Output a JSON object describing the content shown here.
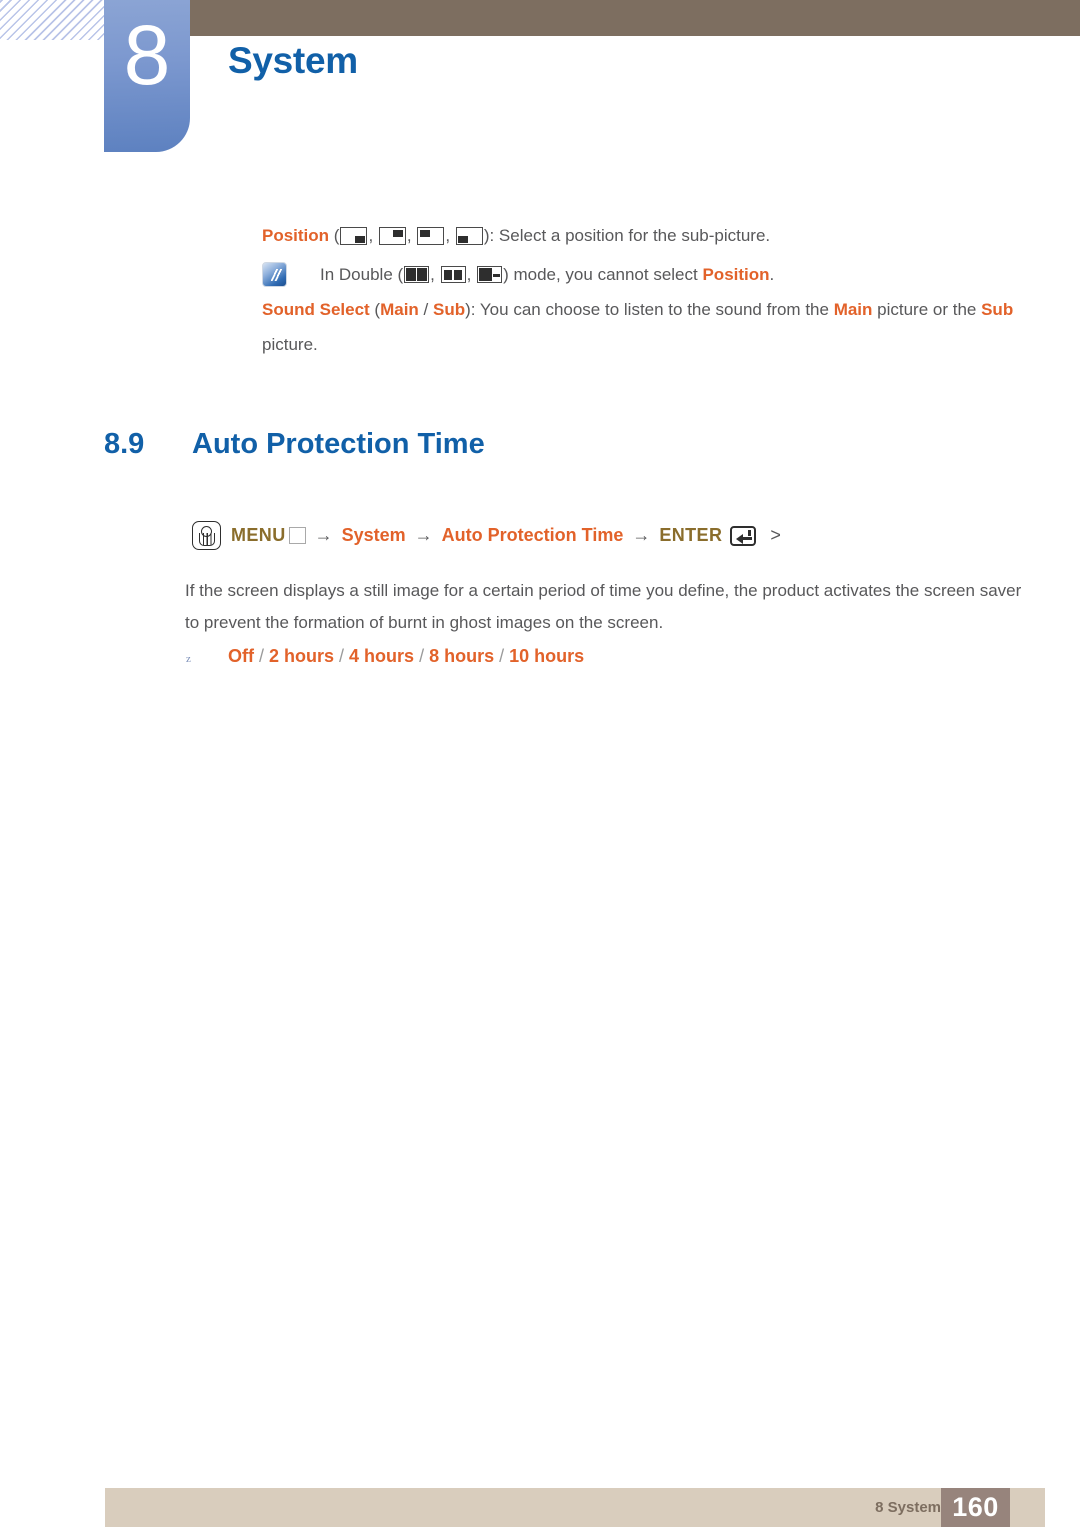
{
  "header": {
    "chapter_number": "8",
    "chapter_title": "System",
    "hatch_icon": "diagonal-hatch-pattern",
    "bar_color": "#7d6e60",
    "tab_color": "#5d81c0",
    "title_color": "#1160a8"
  },
  "notes": {
    "position_note": {
      "keyword": "Position",
      "open_paren": " (",
      "icons": [
        {
          "name": "position-bottom-right-icon",
          "corner": "bottom-right"
        },
        {
          "name": "position-top-right-icon",
          "corner": "top-right"
        },
        {
          "name": "position-top-left-icon",
          "corner": "top-left"
        },
        {
          "name": "position-bottom-left-icon",
          "corner": "bottom-left"
        }
      ],
      "separator": ", ",
      "close_paren": ")",
      "text": ": Select a position for the sub-picture."
    },
    "double_note": {
      "icon": "note-pen-icon",
      "prefix": "In Double (",
      "icons": [
        {
          "name": "double-split-half-icon"
        },
        {
          "name": "double-split-inset-icon"
        },
        {
          "name": "double-large-small-icon"
        }
      ],
      "separator": ", ",
      "middle": ") mode, you cannot select ",
      "keyword": "Position",
      "suffix": "."
    },
    "sound_select": {
      "keyword": "Sound Select",
      "open_paren": " (",
      "option_main": "Main",
      "option_sep": " / ",
      "option_sub": "Sub",
      "close_paren": ")",
      "text_part1": ": You can choose to listen to the sound from the ",
      "inline_main": "Main",
      "text_part2": " picture or the ",
      "inline_sub": "Sub",
      "text_part3": " picture."
    }
  },
  "section": {
    "number": "8.9",
    "title": "Auto Protection Time"
  },
  "menu_path": {
    "hand_icon": "hand-press-icon",
    "menu_label": "MENU",
    "menu_box_icon": "menu-square-icon",
    "arrow": "→",
    "step_system": "System",
    "step_auto_protection_time": "Auto Protection Time",
    "enter_label": "ENTER",
    "enter_icon": "enter-key-icon",
    "trailing": ">"
  },
  "body": {
    "paragraph": "If the screen displays a still image for a certain period of time you define, the product activates the screen saver to prevent the formation of burnt in ghost images on the screen."
  },
  "options": {
    "bullet": "z",
    "values": [
      "Off",
      "2 hours",
      "4 hours",
      "8 hours",
      "10 hours"
    ],
    "separator": " / "
  },
  "footer": {
    "label": "8 System",
    "page_number": "160",
    "bar_color": "#d9cdbd",
    "page_box_color": "#97847c"
  }
}
